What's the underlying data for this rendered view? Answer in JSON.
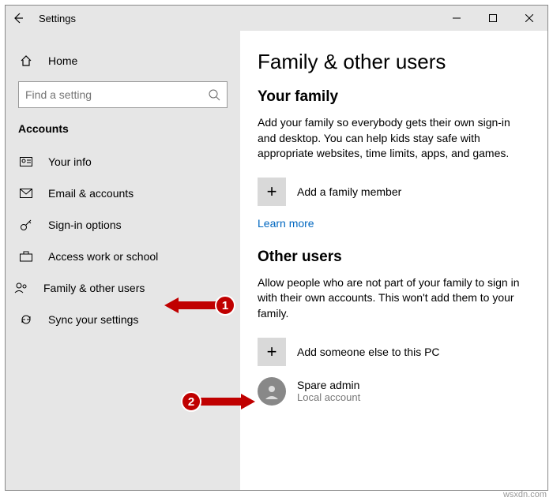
{
  "window": {
    "title": "Settings"
  },
  "sidebar": {
    "home": "Home",
    "search_placeholder": "Find a setting",
    "section": "Accounts",
    "items": [
      {
        "label": "Your info"
      },
      {
        "label": "Email & accounts"
      },
      {
        "label": "Sign-in options"
      },
      {
        "label": "Access work or school"
      },
      {
        "label": "Family & other users"
      },
      {
        "label": "Sync your settings"
      }
    ]
  },
  "main": {
    "heading": "Family & other users",
    "family": {
      "title": "Your family",
      "desc": "Add your family so everybody gets their own sign-in and desktop. You can help kids stay safe with appropriate websites, time limits, apps, and games.",
      "add_label": "Add a family member",
      "learn_more": "Learn more"
    },
    "other": {
      "title": "Other users",
      "desc": "Allow people who are not part of your family to sign in with their own accounts. This won't add them to your family.",
      "add_label": "Add someone else to this PC",
      "user": {
        "name": "Spare admin",
        "type": "Local account"
      }
    }
  },
  "annotations": {
    "badge1": "1",
    "badge2": "2"
  },
  "watermark": "wsxdn.com"
}
